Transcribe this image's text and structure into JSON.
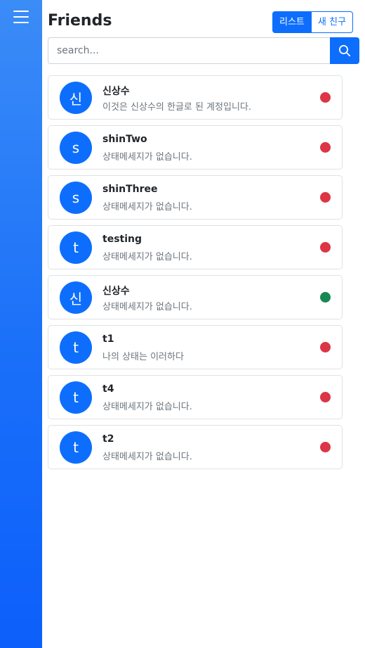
{
  "sidebar": {
    "menu_icon": "hamburger-menu-icon",
    "background": "#1a6ff9"
  },
  "header": {
    "title": "Friends",
    "toggle": {
      "active_label": "리스트",
      "inactive_label": "새 친구"
    }
  },
  "search": {
    "value": "",
    "placeholder": "search...",
    "button_icon": "search-icon"
  },
  "colors": {
    "accent": "#0d6efd",
    "offline": "#dc3545",
    "online": "#198754"
  },
  "friends": [
    {
      "avatar": "신",
      "name": "신상수",
      "status_message": "이것은 신상수의 한글로 된 계정입니다.",
      "status": "offline"
    },
    {
      "avatar": "s",
      "name": "shinTwo",
      "status_message": "상태메세지가 없습니다.",
      "status": "offline"
    },
    {
      "avatar": "s",
      "name": "shinThree",
      "status_message": "상태메세지가 없습니다.",
      "status": "offline"
    },
    {
      "avatar": "t",
      "name": "testing",
      "status_message": "상태메세지가 없습니다.",
      "status": "offline"
    },
    {
      "avatar": "신",
      "name": "신상수",
      "status_message": "상태메세지가 없습니다.",
      "status": "online"
    },
    {
      "avatar": "t",
      "name": "t1",
      "status_message": "나의 상태는 이러하다",
      "status": "offline"
    },
    {
      "avatar": "t",
      "name": "t4",
      "status_message": "상태메세지가 없습니다.",
      "status": "offline"
    },
    {
      "avatar": "t",
      "name": "t2",
      "status_message": "상태메세지가 없습니다.",
      "status": "offline"
    }
  ]
}
